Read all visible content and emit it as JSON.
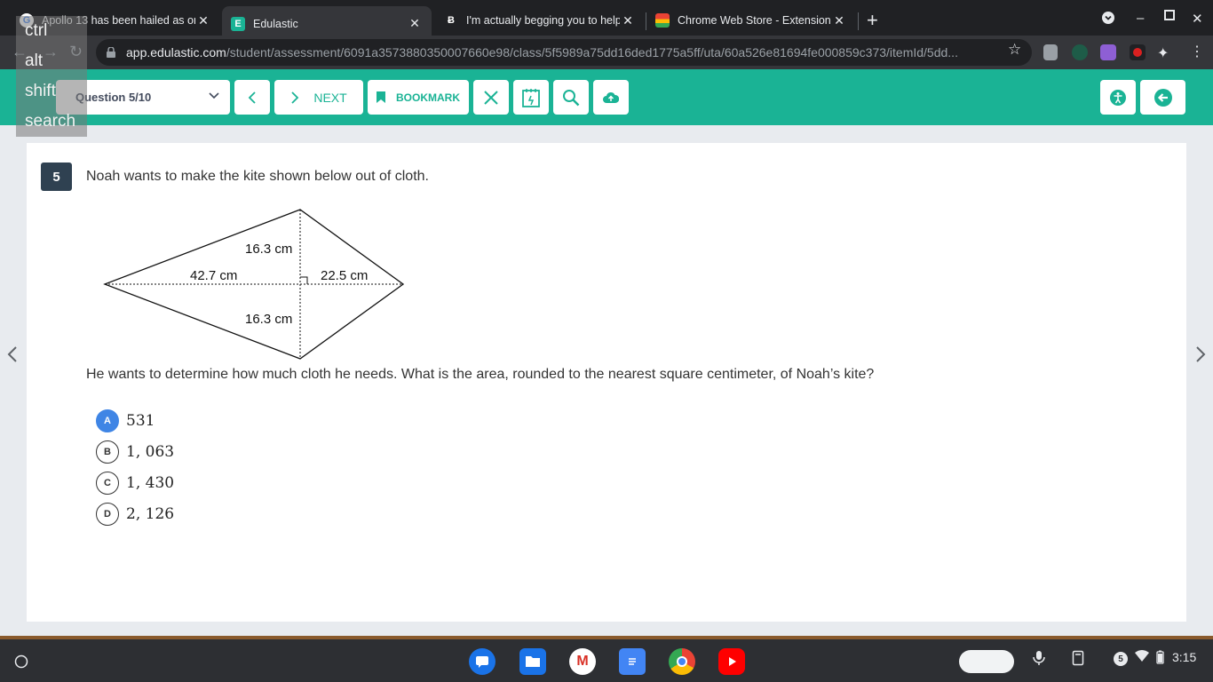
{
  "browser": {
    "tabs": [
      {
        "title": "Apollo 13 has been hailed as on",
        "favicon": "google-icon",
        "active": false
      },
      {
        "title": "Edulastic",
        "favicon": "edulastic-icon",
        "active": true
      },
      {
        "title": "I'm actually begging you to help",
        "favicon": "brainly-icon",
        "active": false
      },
      {
        "title": "Chrome Web Store - Extensions",
        "favicon": "webstore-icon",
        "active": false
      }
    ],
    "url_host": "app.edulastic.com",
    "url_path": "/student/assessment/6091a3573880350007660e98/class/5f5989a75dd16ded1775a5ff/uta/60a526e81694fe000859c373/itemId/5dd..."
  },
  "overlay_keys": [
    "ctrl",
    "alt",
    "shift",
    "search"
  ],
  "header": {
    "question_select": "Question 5/10",
    "next_label": "NEXT",
    "bookmark_label": "BOOKMARK"
  },
  "question": {
    "number": "5",
    "stem": "Noah wants to make the kite shown below out of cloth.",
    "figure": {
      "label_top": "16.3 cm",
      "label_left": "42.7 cm",
      "label_right": "22.5 cm",
      "label_bottom": "16.3 cm"
    },
    "prompt": "He wants to determine how much cloth he needs. What is the area, rounded to the nearest square centimeter, of Noah’s kite?",
    "options": [
      {
        "letter": "A",
        "text": "531",
        "selected": true
      },
      {
        "letter": "B",
        "text": "1, 063",
        "selected": false
      },
      {
        "letter": "C",
        "text": "1, 430",
        "selected": false
      },
      {
        "letter": "D",
        "text": "2, 126",
        "selected": false
      }
    ]
  },
  "shelf": {
    "notification_count": "5",
    "time": "3:15"
  },
  "colors": {
    "header_bg": "#1ab395",
    "selected_option": "#3f85e5",
    "question_badge": "#2f4151"
  }
}
